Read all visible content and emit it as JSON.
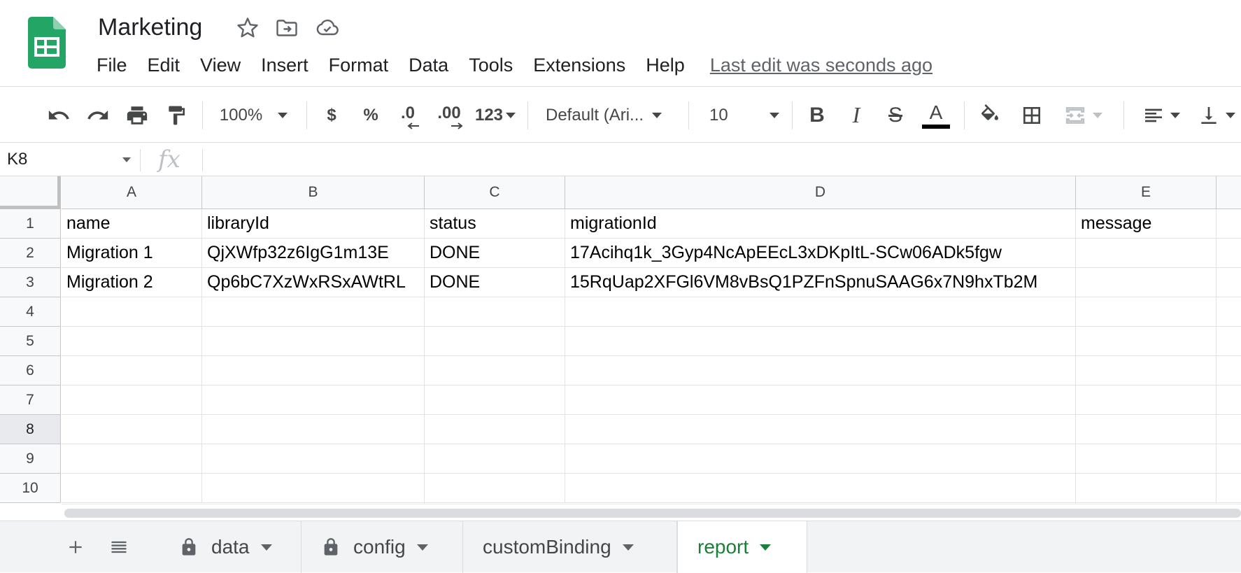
{
  "app": {
    "title": "Marketing",
    "last_edit": "Last edit was seconds ago",
    "brand_color": "#23a566"
  },
  "menu": [
    "File",
    "Edit",
    "View",
    "Insert",
    "Format",
    "Data",
    "Tools",
    "Extensions",
    "Help"
  ],
  "toolbar": {
    "zoom": "100%",
    "currency": "$",
    "percent": "%",
    "decrease_decimal": ".0",
    "increase_decimal": ".00",
    "more_formats": "123",
    "font": "Default (Ari...",
    "font_size": "10",
    "bold": "B",
    "italic": "I",
    "strikethrough": "S",
    "text_color_glyph": "A"
  },
  "formula_bar": {
    "name_box": "K8",
    "fx": "fx",
    "value": ""
  },
  "grid": {
    "columns": [
      "A",
      "B",
      "C",
      "D",
      "E"
    ],
    "row_numbers": [
      "1",
      "2",
      "3",
      "4",
      "5",
      "6",
      "7",
      "8",
      "9",
      "10"
    ],
    "active_row": "8",
    "rows": [
      [
        "name",
        "libraryId",
        "status",
        "migrationId",
        "message"
      ],
      [
        "Migration 1",
        "QjXWfp32z6IgG1m13E",
        "DONE",
        "17Acihq1k_3Gyp4NcApEEcL3xDKpItL-SCw06ADk5fgw",
        ""
      ],
      [
        "Migration 2",
        "Qp6bC7XzWxRSxAWtRL",
        "DONE",
        "15RqUap2XFGl6VM8vBsQ1PZFnSpnuSAAG6x7N9hxTb2M",
        ""
      ],
      [
        "",
        "",
        "",
        "",
        ""
      ],
      [
        "",
        "",
        "",
        "",
        ""
      ],
      [
        "",
        "",
        "",
        "",
        ""
      ],
      [
        "",
        "",
        "",
        "",
        ""
      ],
      [
        "",
        "",
        "",
        "",
        ""
      ],
      [
        "",
        "",
        "",
        "",
        ""
      ],
      [
        "",
        "",
        "",
        "",
        ""
      ]
    ]
  },
  "sheets": {
    "tabs": [
      {
        "label": "data",
        "locked": true,
        "active": false
      },
      {
        "label": "config",
        "locked": true,
        "active": false
      },
      {
        "label": "customBinding",
        "locked": false,
        "active": false
      },
      {
        "label": "report",
        "locked": false,
        "active": true
      }
    ],
    "active_color": "#188038"
  }
}
